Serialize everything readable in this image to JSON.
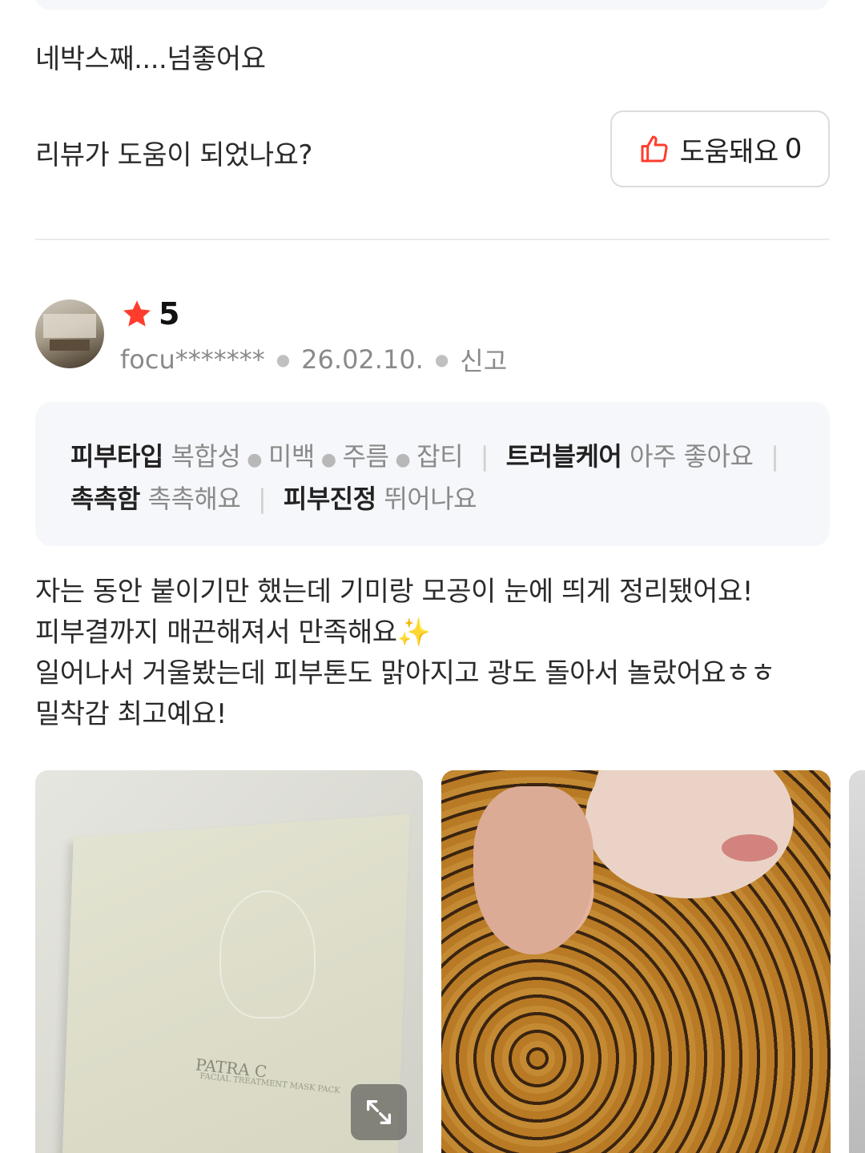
{
  "previous_review": {
    "text": "네박스째....넘좋어요"
  },
  "helpful": {
    "question": "리뷰가 도움이 되었나요?",
    "button_label": "도움돼요",
    "count": "0"
  },
  "review": {
    "rating": "5",
    "username": "focu*******",
    "date": "26.02.10.",
    "report_label": "신고",
    "attributes": {
      "skin_type_key": "피부타입",
      "skin_types": [
        "복합성",
        "미백",
        "주름",
        "잡티"
      ],
      "trouble_key": "트러블케어",
      "trouble_val": "아주 좋아요",
      "moist_key": "촉촉함",
      "moist_val": "촉촉해요",
      "soothe_key": "피부진정",
      "soothe_val": "뛰어나요"
    },
    "body_lines": [
      "자는 동안 붙이기만 했는데 기미랑 모공이 눈에 띄게 정리됐어요!",
      "피부결까지 매끈해져서 만족해요✨",
      "일어나서 거울봤는데 피부톤도 맑아지고 광도 돌아서 놀랐어요ㅎㅎ",
      "밀착감 최고예요!"
    ],
    "photos": [
      {
        "brand": "PATRA C",
        "sub": "FACIAL TREATMENT MASK PACK"
      },
      {},
      {}
    ]
  },
  "colors": {
    "star": "#ff3d2e",
    "thumb": "#ff3d2e",
    "attr_bg": "#f6f7fa"
  },
  "icons": {
    "rating": "star-icon",
    "helpful": "thumbs-up-icon",
    "expand": "expand-icon"
  }
}
